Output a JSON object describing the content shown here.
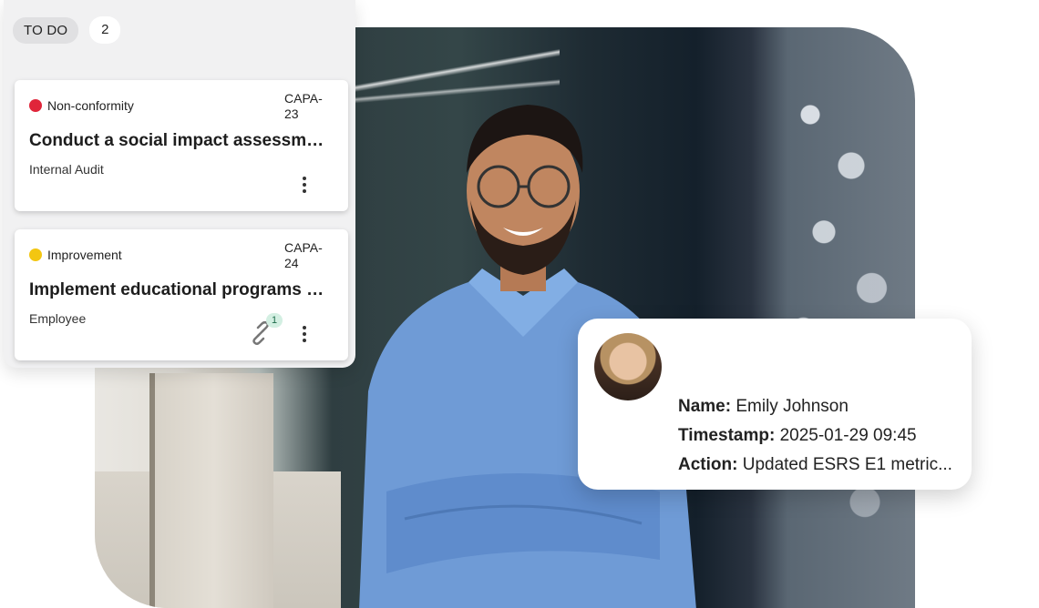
{
  "column": {
    "title": "TO DO",
    "count": "2",
    "tasks": [
      {
        "type": "Non-conformity",
        "type_color": "#e0253a",
        "id": "CAPA-\n23",
        "title": "Conduct a social impact assessment",
        "source": "Internal Audit"
      },
      {
        "type": "Improvement",
        "type_color": "#f3c611",
        "id": "CAPA-\n24",
        "title": "Implement educational programs o...",
        "source": "Employee",
        "links": "1",
        "link_icon": "link-icon"
      }
    ]
  },
  "activity": {
    "name_label": "Name:",
    "name": "Emily Johnson",
    "timestamp_label": "Timestamp:",
    "timestamp": "2025-01-29 09:45",
    "action_label": "Action:",
    "action": "Updated ESRS E1 metric..."
  }
}
